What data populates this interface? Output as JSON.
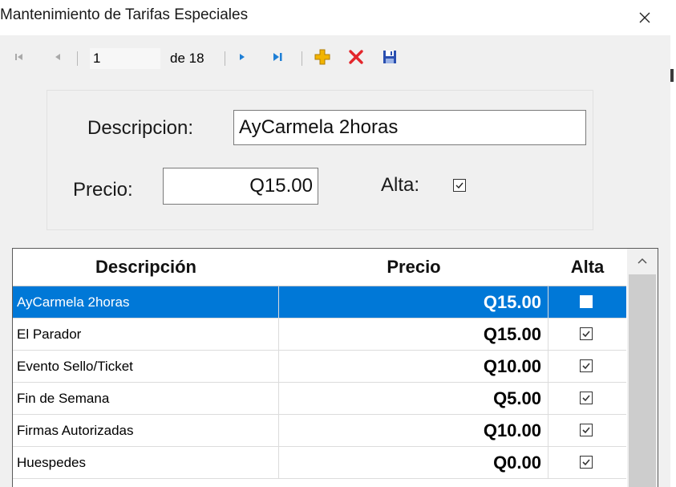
{
  "window": {
    "title": "Mantenimiento de Tarifas Especiales"
  },
  "navigator": {
    "current_page": "1",
    "of_label": "de 18"
  },
  "form": {
    "description_label": "Descripcion:",
    "description_value": "AyCarmela 2horas",
    "price_label": "Precio:",
    "price_value": "Q15.00",
    "alta_label": "Alta:",
    "alta_checked": true
  },
  "grid": {
    "columns": [
      "Descripción",
      "Precio",
      "Alta"
    ],
    "rows": [
      {
        "descripcion": "AyCarmela 2horas",
        "precio": "Q15.00",
        "alta": true,
        "selected": true
      },
      {
        "descripcion": "El Parador",
        "precio": "Q15.00",
        "alta": true,
        "selected": false
      },
      {
        "descripcion": "Evento Sello/Ticket",
        "precio": "Q10.00",
        "alta": true,
        "selected": false
      },
      {
        "descripcion": "Fin de Semana",
        "precio": "Q5.00",
        "alta": true,
        "selected": false
      },
      {
        "descripcion": "Firmas Autorizadas",
        "precio": "Q10.00",
        "alta": true,
        "selected": false
      },
      {
        "descripcion": "Huespedes",
        "precio": "Q0.00",
        "alta": true,
        "selected": false
      }
    ]
  },
  "colors": {
    "selection": "#0078d7",
    "nav_blue": "#1e7fd6",
    "add_yellow": "#f2b400",
    "delete_red": "#e3262b",
    "save_blue": "#2a4fb0"
  },
  "icons": {
    "close": "close-icon",
    "first": "move-first-icon",
    "previous": "move-previous-icon",
    "next": "move-next-icon",
    "last": "move-last-icon",
    "add": "add-icon",
    "delete": "delete-icon",
    "save": "save-icon"
  }
}
